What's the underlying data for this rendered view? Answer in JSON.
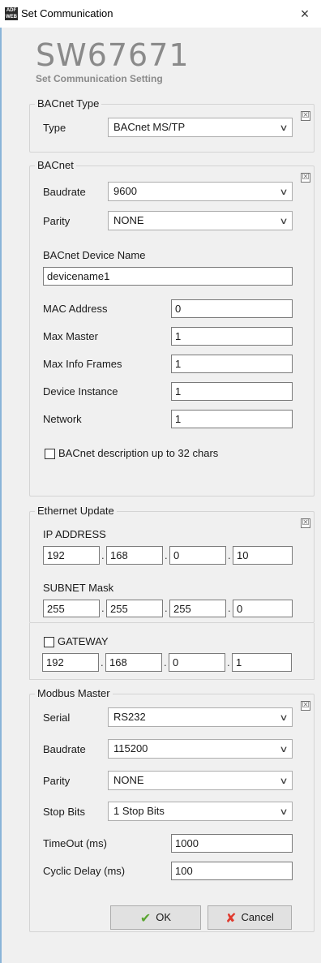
{
  "window": {
    "title": "Set Communication",
    "app_icon_text": "ADF WEB",
    "close_glyph": "×"
  },
  "header": {
    "code": "SW67671",
    "subtitle": "Set Communication Setting"
  },
  "collapse_glyph": "☒",
  "chevron_glyph": "∨",
  "bacnet_type": {
    "legend": "BACnet Type",
    "type_label": "Type",
    "type_value": "BACnet MS/TP"
  },
  "bacnet": {
    "legend": "BACnet",
    "baudrate_label": "Baudrate",
    "baudrate_value": "9600",
    "parity_label": "Parity",
    "parity_value": "NONE",
    "device_name_label": "BACnet Device Name",
    "device_name_value": "devicename1",
    "mac_label": "MAC Address",
    "mac_value": "0",
    "max_master_label": "Max Master",
    "max_master_value": "1",
    "max_info_label": "Max Info Frames",
    "max_info_value": "1",
    "device_instance_label": "Device Instance",
    "device_instance_value": "1",
    "network_label": "Network",
    "network_value": "1",
    "desc32_label": "BACnet description up to 32 chars",
    "desc32_checked": false
  },
  "ethernet": {
    "legend": "Ethernet Update",
    "ip_label": "IP ADDRESS",
    "ip": [
      "192",
      "168",
      "0",
      "10"
    ],
    "subnet_label": "SUBNET Mask",
    "subnet": [
      "255",
      "255",
      "255",
      "0"
    ],
    "gateway_label": "GATEWAY",
    "gateway_checked": false,
    "gateway": [
      "192",
      "168",
      "0",
      "1"
    ],
    "separator": "."
  },
  "modbus": {
    "legend": "Modbus Master",
    "serial_label": "Serial",
    "serial_value": "RS232",
    "baudrate_label": "Baudrate",
    "baudrate_value": "115200",
    "parity_label": "Parity",
    "parity_value": "NONE",
    "stopbits_label": "Stop Bits",
    "stopbits_value": "1 Stop Bits",
    "timeout_label": "TimeOut (ms)",
    "timeout_value": "1000",
    "cyclic_label": "Cyclic Delay (ms)",
    "cyclic_value": "100"
  },
  "buttons": {
    "ok_label": "OK",
    "cancel_label": "Cancel",
    "ok_color": "#5aa531",
    "cancel_color": "#e03a2e"
  }
}
